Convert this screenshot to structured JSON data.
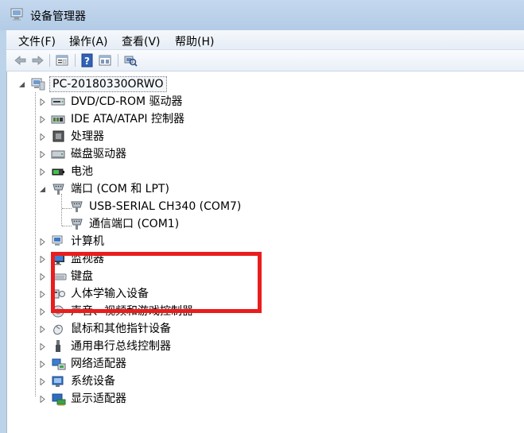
{
  "window": {
    "title": "设备管理器"
  },
  "menu": [
    {
      "label": "文件(F)"
    },
    {
      "label": "操作(A)"
    },
    {
      "label": "查看(V)"
    },
    {
      "label": "帮助(H)"
    }
  ],
  "toolbar": [
    {
      "icon": "back-arrow-icon"
    },
    {
      "icon": "forward-arrow-icon"
    },
    {
      "icon": "properties-icon"
    },
    {
      "icon": "help-icon"
    },
    {
      "icon": "show-hide-tree-icon"
    },
    {
      "icon": "scan-hardware-icon"
    }
  ],
  "tree": {
    "root": {
      "label": "PC-20180330ORWO",
      "icon": "computer-icon"
    },
    "items": [
      {
        "label": "DVD/CD-ROM 驱动器",
        "icon": "dvd-drive-icon",
        "expanded": false
      },
      {
        "label": "IDE ATA/ATAPI 控制器",
        "icon": "ide-controller-icon",
        "expanded": false
      },
      {
        "label": "处理器",
        "icon": "processor-icon",
        "expanded": false
      },
      {
        "label": "磁盘驱动器",
        "icon": "disk-drive-icon",
        "expanded": false
      },
      {
        "label": "电池",
        "icon": "battery-icon",
        "expanded": false
      },
      {
        "label": "端口 (COM 和 LPT)",
        "icon": "port-icon",
        "expanded": true,
        "children": [
          {
            "label": "USB-SERIAL CH340 (COM7)",
            "icon": "port-icon"
          },
          {
            "label": "通信端口 (COM1)",
            "icon": "port-icon"
          }
        ]
      },
      {
        "label": "计算机",
        "icon": "computer-icon",
        "expanded": false
      },
      {
        "label": "监视器",
        "icon": "monitor-icon",
        "expanded": false
      },
      {
        "label": "键盘",
        "icon": "keyboard-icon",
        "expanded": false
      },
      {
        "label": "人体学输入设备",
        "icon": "hid-icon",
        "expanded": false
      },
      {
        "label": "声音、视频和游戏控制器",
        "icon": "speaker-icon",
        "expanded": false
      },
      {
        "label": "鼠标和其他指针设备",
        "icon": "mouse-icon",
        "expanded": false
      },
      {
        "label": "通用串行总线控制器",
        "icon": "usb-icon",
        "expanded": false
      },
      {
        "label": "网络适配器",
        "icon": "network-adapter-icon",
        "expanded": false
      },
      {
        "label": "系统设备",
        "icon": "system-device-icon",
        "expanded": false
      },
      {
        "label": "显示适配器",
        "icon": "display-adapter-icon",
        "expanded": false
      }
    ]
  },
  "colors": {
    "highlight": "#ea1d1d",
    "titlebar": "#bcd3ea"
  }
}
